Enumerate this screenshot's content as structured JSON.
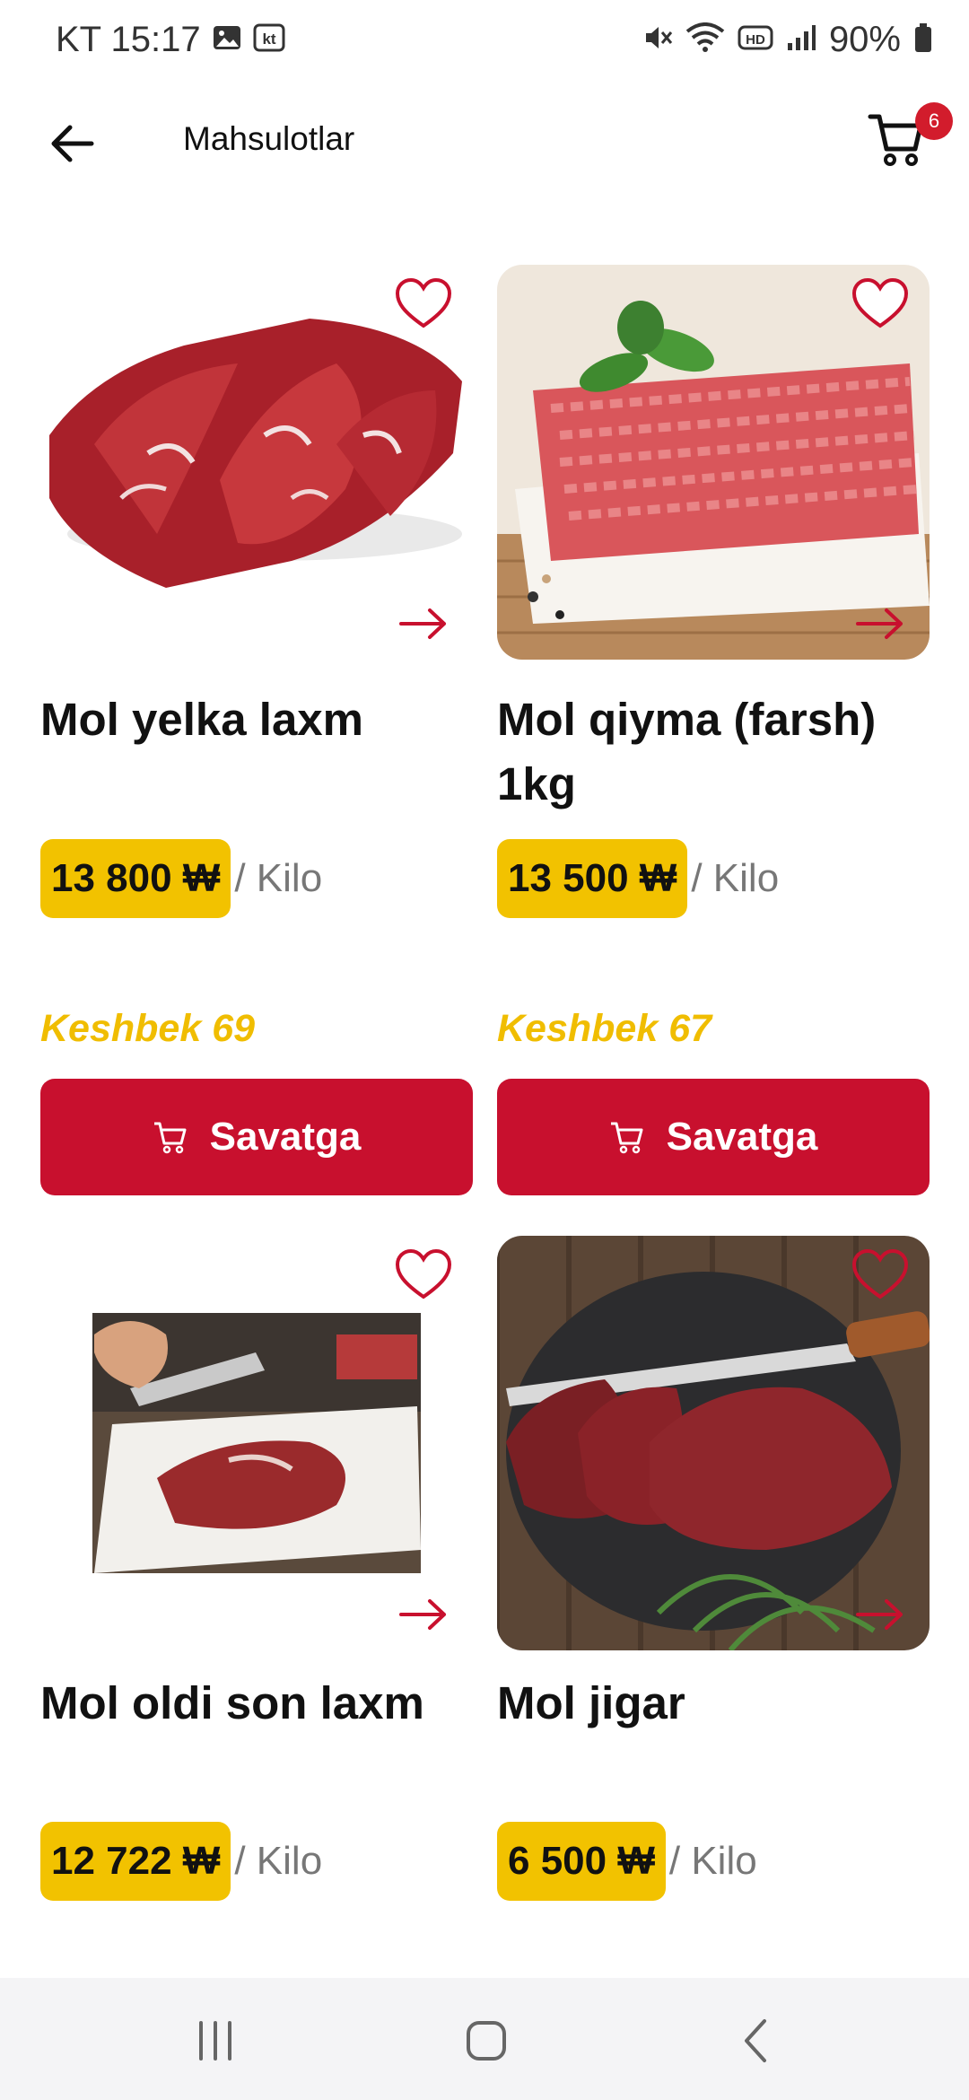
{
  "status_bar": {
    "time": "KT 15:17",
    "battery": "90%",
    "icons": [
      "image-icon",
      "kt-icon",
      "mute-icon",
      "wifi-icon",
      "hd-icon",
      "signal-icon",
      "battery-icon"
    ]
  },
  "appbar": {
    "title": "Mahsulotlar",
    "cart_count": "6"
  },
  "colors": {
    "accent_red": "#c8102e",
    "price_yellow": "#f2c200",
    "cashback_yellow": "#f0bd00"
  },
  "products": [
    {
      "name": "Mol yelka laxm",
      "price": "13 800 ₩",
      "unit": "/ Kilo",
      "cashback": "Keshbek 69",
      "button": "Savatga"
    },
    {
      "name": "Mol qiyma (farsh) 1kg",
      "price": "13 500 ₩",
      "unit": "/ Kilo",
      "cashback": "Keshbek 67",
      "button": "Savatga"
    },
    {
      "name": "Mol oldi son laxm",
      "price": "12 722 ₩",
      "unit": "/ Kilo"
    },
    {
      "name": "Mol jigar",
      "price": "6 500 ₩",
      "unit": "/ Kilo"
    }
  ],
  "navbar": {
    "items": [
      "recents-icon",
      "home-icon",
      "back-icon"
    ]
  }
}
